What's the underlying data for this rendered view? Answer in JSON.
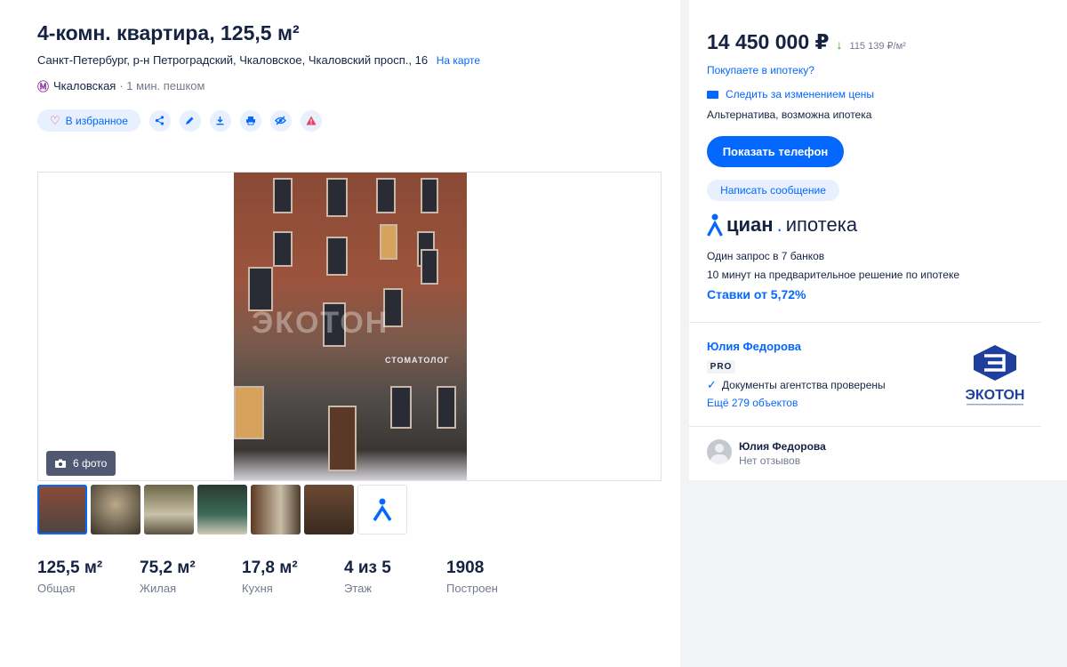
{
  "listing": {
    "title": "4-комн. квартира, 125,5 м²",
    "address": "Санкт-Петербург, р-н Петроградский, Чкаловское, Чкаловский просп., 16",
    "map_link": "На карте",
    "metro_icon": "Ⓜ",
    "metro_station": "Чкаловская",
    "metro_walk": "· 1 мин. пешком"
  },
  "actions": {
    "favorite_label": "В избранное",
    "icons": [
      "share-icon",
      "edit-icon",
      "download-icon",
      "print-icon",
      "hide-icon",
      "report-icon"
    ]
  },
  "gallery": {
    "photo_count": "6 фото",
    "watermark": "ЭКОТОН",
    "sign_text": "СТОМАТОЛОГ",
    "thumbnails": 6
  },
  "facts": [
    {
      "value": "125,5 м²",
      "label": "Общая"
    },
    {
      "value": "75,2 м²",
      "label": "Жилая"
    },
    {
      "value": "17,8 м²",
      "label": "Кухня"
    },
    {
      "value": "4 из 5",
      "label": "Этаж"
    },
    {
      "value": "1908",
      "label": "Построен"
    }
  ],
  "sidebar": {
    "price": "14 450 000 ₽",
    "price_per_m": "115 139 ₽/м²",
    "mortgage_link": "Покупаете в ипотеку?",
    "watch_price_link": "Следить за изменением цены",
    "deal_type": "Альтернатива, возможна ипотека",
    "phone_button": "Показать телефон",
    "message_button": "Написать сообщение"
  },
  "promo": {
    "brand": "циан",
    "brand_dot": ".",
    "brand_sub": "ипотека",
    "line1": "Один запрос в 7 банков",
    "line2": "10 минут на предварительное решение по ипотеке",
    "rates": "Ставки от 5,72%"
  },
  "agent": {
    "name": "Юлия Федорова",
    "badge": "PRO",
    "verified": "Документы агентства проверены",
    "more_link": "Ещё 279 объектов",
    "agency_logo_text": "ЭКОТОН"
  },
  "reviews": {
    "name": "Юлия Федорова",
    "status": "Нет отзывов"
  },
  "colors": {
    "accent": "#0468ff",
    "text": "#152242",
    "muted": "#737a8e",
    "price_drop": "#34ac0a"
  }
}
